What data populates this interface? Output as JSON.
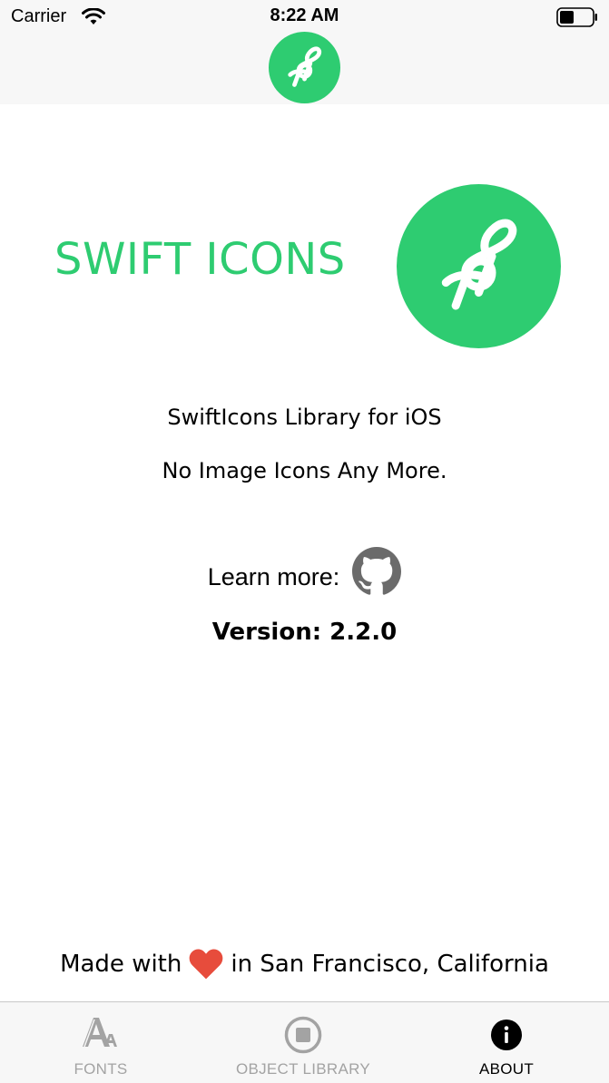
{
  "status_bar": {
    "carrier": "Carrier",
    "time": "8:22 AM"
  },
  "colors": {
    "accent": "#2ecc71",
    "heart": "#e74c3c",
    "tab_inactive": "#a3a3a3",
    "tab_active": "#000000"
  },
  "nav": {
    "logo_icon": "swift-icons-logo-icon"
  },
  "hero": {
    "title": "SWIFT ICONS",
    "logo_icon": "swift-icons-logo-icon"
  },
  "info": {
    "line1": "SwiftIcons Library for iOS",
    "line2": "No Image Icons Any More.",
    "learn_more": "Learn more:",
    "learn_more_icon": "github-icon",
    "version": "Version: 2.2.0"
  },
  "footer": {
    "made_with": "Made with",
    "heart_icon": "heart-icon",
    "location": "in San Francisco, California"
  },
  "tabs": [
    {
      "label": "FONTS",
      "icon": "fonts-icon",
      "active": false
    },
    {
      "label": "OBJECT LIBRARY",
      "icon": "object-library-icon",
      "active": false
    },
    {
      "label": "ABOUT",
      "icon": "info-icon",
      "active": true
    }
  ]
}
